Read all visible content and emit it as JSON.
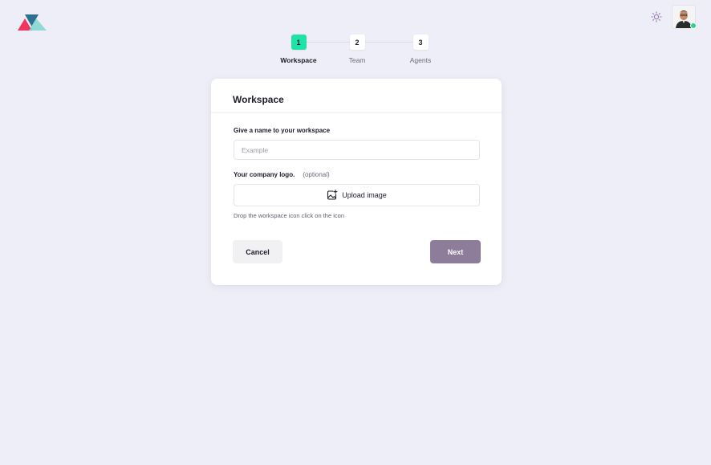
{
  "header": {
    "logo_icon": "triangle-logo-icon",
    "theme_icon": "sun-icon",
    "avatar_icon": "user-avatar",
    "online_status_color": "#2fd08a"
  },
  "stepper": {
    "active_color": "#1ee3a6",
    "steps": [
      {
        "number": "1",
        "label": "Workspace",
        "active": true
      },
      {
        "number": "2",
        "label": "Team",
        "active": false
      },
      {
        "number": "3",
        "label": "Agents",
        "active": false
      }
    ]
  },
  "card": {
    "title": "Workspace",
    "name_field": {
      "label": "Give a name to your workspace",
      "placeholder": "Example",
      "value": ""
    },
    "logo_field": {
      "label": "Your company logo.",
      "optional": "(optional)",
      "upload_label": "Upload image",
      "upload_icon": "image-plus-icon",
      "hint": "Drop the workspace icon click on the icon"
    },
    "actions": {
      "cancel_label": "Cancel",
      "next_label": "Next",
      "next_color": "#8e7c9b"
    }
  }
}
